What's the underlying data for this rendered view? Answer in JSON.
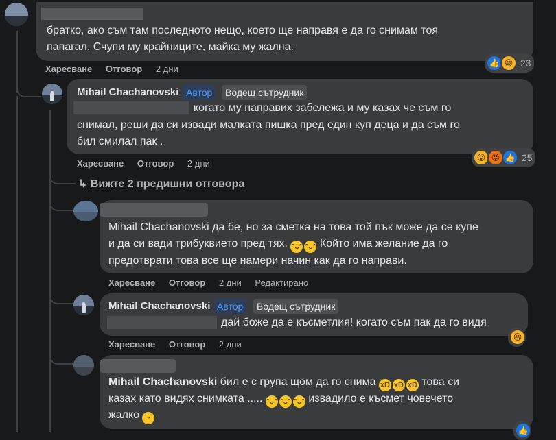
{
  "comments": [
    {
      "text": "братко, ако съм там последното нещо, което ще направя е да го снимам тоя папагал. Счупи му крайниците, майка му жална.",
      "line1": "братко, ако съм там последното нещо, което ще направя е да го снимам тоя",
      "line2": "папагал. Счупи му крайниците, майка му жална.",
      "like": "Харесване",
      "reply": "Отговор",
      "time": "2 дни",
      "reaction_count": "23",
      "reactions": [
        "like-icon",
        "haha-icon"
      ]
    },
    {
      "author": "Mihail Chachanovski",
      "badge_author": "Автор",
      "badge_role": "Водещ сътрудник",
      "line1": "когато му направих забележа и му казах че съм го",
      "line2": "снимал, реши да си извади малката пишка пред един куп деца и да съм го",
      "line3": "бил смилал пак .",
      "like": "Харесване",
      "reply": "Отговор",
      "time": "2 дни",
      "reaction_count": "25",
      "reactions": [
        "wow-icon",
        "angry-icon",
        "like-icon"
      ]
    },
    {
      "line1": "Mihail Chachanovski да бе, но за сметка на това той пък може да се купе",
      "line2": "и да си вади трибуквието пред тях.",
      "line2b": "Който има желание да го",
      "line3": "предотврати това все ще намери начин как да го направи.",
      "like": "Харесване",
      "reply": "Отговор",
      "time": "2 дни",
      "edited": "Редактирано"
    },
    {
      "author": "Mihail Chachanovski",
      "badge_author": "Автор",
      "badge_role": "Водещ сътрудник",
      "line1": "дай боже да е късметлия! когато съм пак да го видя",
      "like": "Харесване",
      "reply": "Отговор",
      "time": "2 дни"
    },
    {
      "author": "Mihail Chachanovski",
      "line1a": "бил е с група щом да го снима",
      "line1b": "това си",
      "line2a": "казах като видях снимката .....",
      "line2b": "извадило е късмет човечето",
      "line3": "жалко"
    }
  ],
  "view_more": "Вижте 2 предишни отговора",
  "colors": {
    "background": "#18191a",
    "bubble": "#3a3b3c",
    "accent": "#4599ff",
    "like": "#1b74e4"
  }
}
